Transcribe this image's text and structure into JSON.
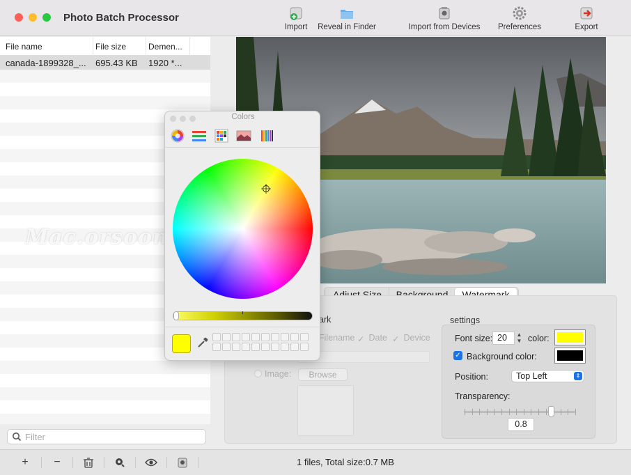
{
  "app": {
    "title": "Photo Batch Processor"
  },
  "toolbar": {
    "import": "Import",
    "reveal": "Reveal in Finder",
    "import_devices": "Import from Devices",
    "preferences": "Preferences",
    "export": "Export"
  },
  "file_table": {
    "headers": [
      "File name",
      "File size",
      "Demen..."
    ],
    "rows": [
      {
        "name": "canada-1899328_...",
        "size": "695.43 KB",
        "dim": "1920 *..."
      }
    ]
  },
  "filter": {
    "placeholder": "Filter"
  },
  "status": "1 files, Total size:0.7 MB",
  "preview": {
    "watermark_text": "Mac.orsoon.com"
  },
  "tabs": {
    "adjust_size": "Adjust Size",
    "background": "Background",
    "watermark": "Watermark"
  },
  "watermark_panel": {
    "section_label": "ark",
    "filename": "Filename",
    "date": "Date",
    "device": "Device",
    "image_label": "Image:",
    "browse": "Browse"
  },
  "settings": {
    "title": "settings",
    "font_size_label": "Font size:",
    "font_size_value": "20",
    "color_label": "color:",
    "font_color": "#ffff00",
    "bg_color_label": "Background color:",
    "bg_color_checked": true,
    "bg_color": "#000000",
    "position_label": "Position:",
    "position_value": "Top Left",
    "transparency_label": "Transparency:",
    "transparency_value": "0.8"
  },
  "colors_panel": {
    "title": "Colors",
    "current_color": "#ffff00"
  },
  "accent": "#1a73e8"
}
